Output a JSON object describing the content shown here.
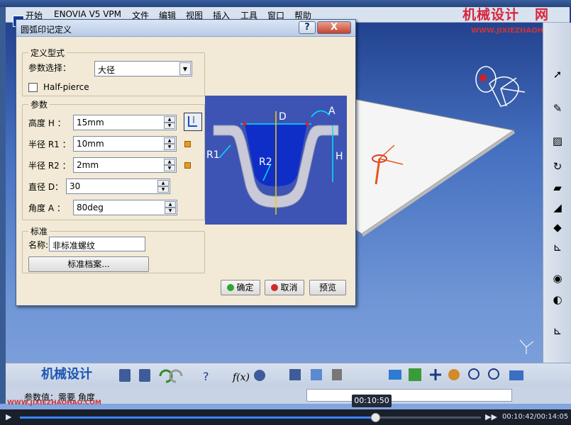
{
  "menu": {
    "items": [
      "开始",
      "ENOVIA V5 VPM",
      "文件",
      "编辑",
      "视图",
      "插入",
      "工具",
      "窗口",
      "帮助"
    ]
  },
  "watermark": {
    "title": "机械设计",
    "title_tail": "网",
    "url": "WWW.JIXIEZHAOHAO.COM",
    "bottom_title": "机械设计",
    "bottom_url": "WWW.JIXIEZHAOHAO.COM"
  },
  "dialog": {
    "title": "圆弧印记定义",
    "help_label": "?",
    "close_label": "X",
    "definition_group": "定义型式",
    "param_select_label": "参数选择：",
    "param_select_value": "大径",
    "half_pierce_label": "Half-pierce",
    "half_pierce_checked": false,
    "params_group": "参数",
    "params": [
      {
        "label": "高度 H ：",
        "value": "15mm"
      },
      {
        "label": "半径 R1 ：",
        "value": "10mm"
      },
      {
        "label": "半径 R2 ：",
        "value": "2mm"
      },
      {
        "label": "直径 D：",
        "value": "30"
      },
      {
        "label": "角度 A  ：",
        "value": "80deg"
      }
    ],
    "standard_group": "标准",
    "name_label": "名称:",
    "name_value": "非标准螺纹",
    "standard_files_button": "标准档案...",
    "ok_button": "确定",
    "cancel_button": "取消",
    "preview_button": "预览",
    "diagram_labels": {
      "d": "D",
      "a": "A",
      "r1": "R1",
      "r2": "R2",
      "h": "H"
    }
  },
  "status": {
    "text": "参数值：需要 角度",
    "command_value": ""
  },
  "player": {
    "current_tip": "00:10:50",
    "time_display": "00:10:42/00:14:05",
    "progress_fraction": 0.77
  },
  "colors": {
    "accent": "#1d56b3",
    "watermark_red": "#d8253a"
  }
}
